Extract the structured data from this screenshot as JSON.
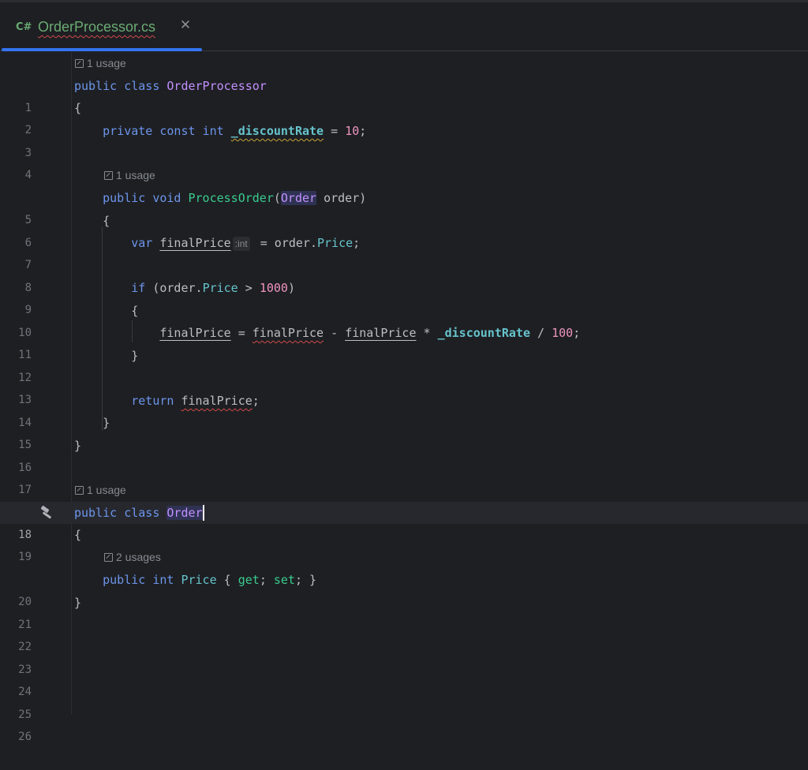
{
  "tab": {
    "lang_badge": "C#",
    "file_name": "OrderProcessor.cs",
    "close_glyph": "✕"
  },
  "hints": {
    "class_usage": "1 usage",
    "method_usage": "1 usage",
    "order_usage": "1 usage",
    "price_usages": "2 usages"
  },
  "inlay": {
    "final_price_type": ":int"
  },
  "line_numbers": [
    "1",
    "2",
    "3",
    "4",
    "5",
    "6",
    "7",
    "8",
    "9",
    "10",
    "11",
    "12",
    "13",
    "14",
    "15",
    "16",
    "17",
    "18",
    "19",
    "20",
    "21",
    "22",
    "23",
    "24",
    "25",
    "26"
  ],
  "code": {
    "l1": {
      "kw1": "public",
      "kw2": "class",
      "name": "OrderProcessor"
    },
    "l2": {
      "text": "{"
    },
    "l3": {
      "kw1": "private",
      "kw2": "const",
      "kw3": "int",
      "field": "_discountRate",
      "op": " = ",
      "num": "10",
      "end": ";"
    },
    "l5": {
      "kw1": "public",
      "kw2": "void",
      "method": "ProcessOrder",
      "p1": "(",
      "type": "Order",
      "p2": " order)"
    },
    "l6": {
      "text": "{"
    },
    "l7": {
      "kw": "var",
      "var": "finalPrice",
      "eq": " = order.",
      "prop": "Price",
      "end": ";"
    },
    "l9": {
      "kw": "if",
      "p1": " (order.",
      "prop": "Price",
      "op": " > ",
      "num": "1000",
      "end": ")"
    },
    "l10": {
      "text": "{"
    },
    "l11": {
      "v1": "finalPrice",
      "o1": " = ",
      "v2": "finalPrice",
      "o2": " - ",
      "v3": "finalPrice",
      "o3": " * ",
      "field": "_discountRate",
      "o4": " / ",
      "num": "100",
      "end": ";"
    },
    "l12": {
      "text": "}"
    },
    "l14": {
      "kw": "return",
      "var": "finalPrice",
      "end": ";"
    },
    "l15": {
      "text": "}"
    },
    "l16": {
      "text": "}"
    },
    "l18": {
      "kw1": "public",
      "kw2": "class",
      "name": "Order"
    },
    "l19": {
      "text": "{"
    },
    "l20": {
      "kw1": "public",
      "kw2": "int",
      "prop": "Price",
      "b1": " { ",
      "get": "get",
      "s1": "; ",
      "set": "set",
      "b2": "; }"
    },
    "l21": {
      "text": "}"
    }
  },
  "colors": {
    "keyword": "#6c95eb",
    "class": "#c191ff",
    "field": "#66c3cc",
    "method": "#39cc8f",
    "number": "#ed94c0",
    "tab_accent": "#3574f0",
    "file_name": "#6aab73"
  },
  "icons": {
    "gutter": "hammer-icon",
    "hint": "usages-link-icon",
    "tab": "close-icon"
  }
}
